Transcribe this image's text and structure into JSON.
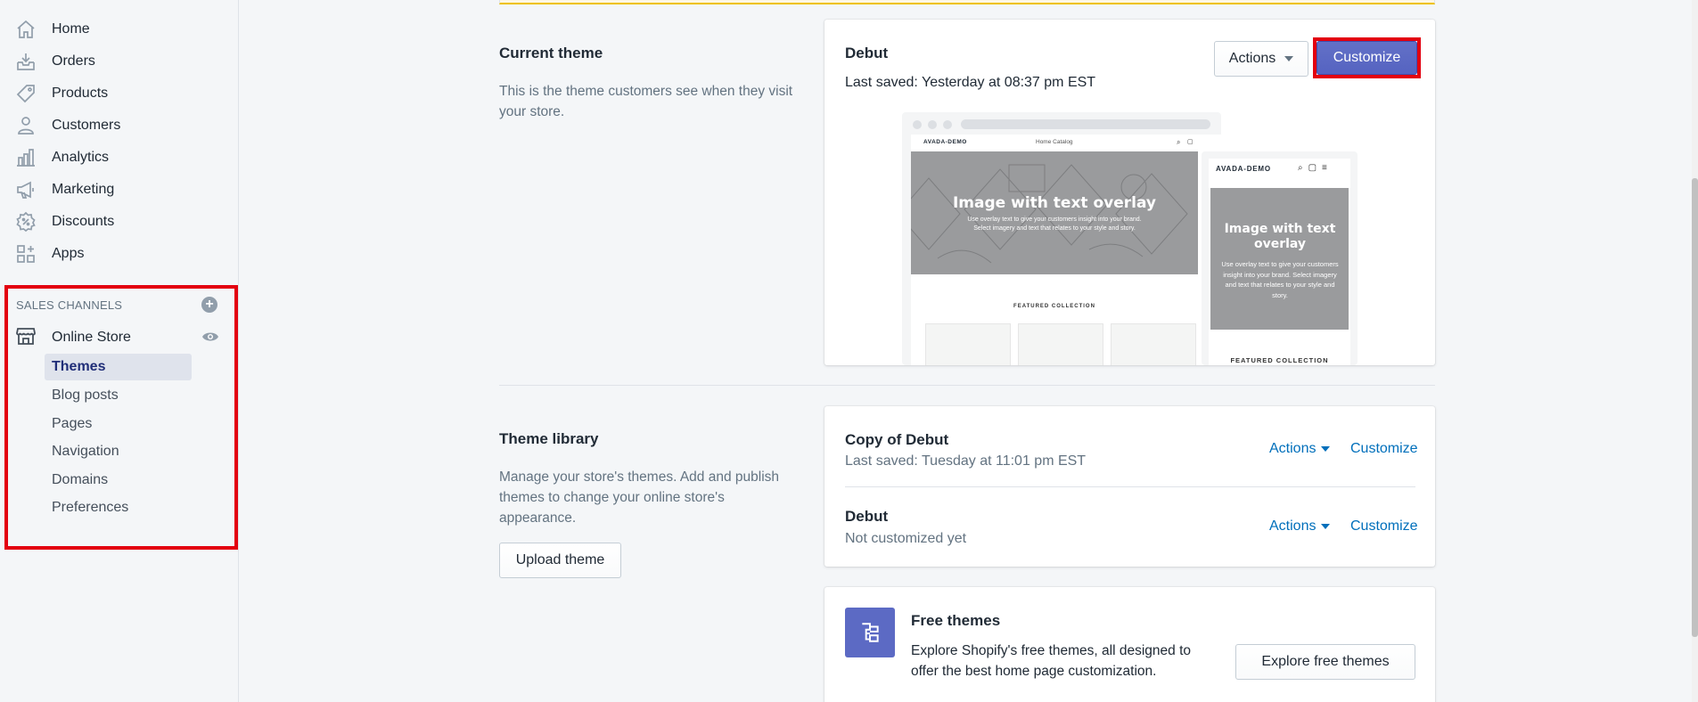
{
  "sidebar": {
    "items": [
      {
        "label": "Home",
        "icon": "home-icon"
      },
      {
        "label": "Orders",
        "icon": "orders-icon"
      },
      {
        "label": "Products",
        "icon": "tag-icon"
      },
      {
        "label": "Customers",
        "icon": "person-icon"
      },
      {
        "label": "Analytics",
        "icon": "bar-chart-icon"
      },
      {
        "label": "Marketing",
        "icon": "megaphone-icon"
      },
      {
        "label": "Discounts",
        "icon": "discount-icon"
      },
      {
        "label": "Apps",
        "icon": "apps-icon"
      }
    ],
    "sales_channels_header": "SALES CHANNELS",
    "online_store": "Online Store",
    "sub_items": [
      "Themes",
      "Blog posts",
      "Pages",
      "Navigation",
      "Domains",
      "Preferences"
    ]
  },
  "current_theme": {
    "section_title": "Current theme",
    "section_desc": "This is the theme customers see when they visit your store.",
    "theme_name": "Debut",
    "last_saved": "Last saved: Yesterday at 08:37 pm EST",
    "actions_label": "Actions",
    "customize_label": "Customize",
    "preview": {
      "brand": "AVADA-DEMO",
      "nav_text": "Home  Catalog",
      "hero_title": "Image with text overlay",
      "hero_desc": "Use overlay text to give your customers insight into your brand. Select imagery and text that relates to your style and story.",
      "featured": "FEATURED COLLECTION"
    }
  },
  "theme_library": {
    "section_title": "Theme library",
    "section_desc": "Manage your store's themes. Add and publish themes to change your online store's appearance.",
    "upload_label": "Upload theme",
    "themes": [
      {
        "name": "Copy of Debut",
        "status": "Last saved: Tuesday at 11:01 pm EST",
        "actions": "Actions",
        "customize": "Customize"
      },
      {
        "name": "Debut",
        "status": "Not customized yet",
        "actions": "Actions",
        "customize": "Customize"
      }
    ]
  },
  "free_themes": {
    "title": "Free themes",
    "desc": "Explore Shopify's free themes, all designed to offer the best home page customization.",
    "button_label": "Explore free themes"
  },
  "colors": {
    "primary": "#5c6ac4",
    "link": "#006fbb",
    "highlight": "#e3000f",
    "active_nav": "#202e78"
  }
}
